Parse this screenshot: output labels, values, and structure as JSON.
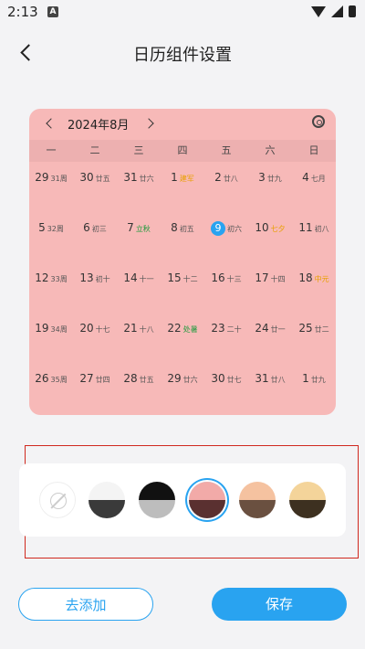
{
  "status": {
    "time": "2:13",
    "notif": "A"
  },
  "header": {
    "title": "日历组件设置"
  },
  "calendar": {
    "month_label": "2024年8月",
    "weekdays": [
      "一",
      "二",
      "三",
      "四",
      "五",
      "六",
      "日"
    ],
    "weeks": [
      [
        {
          "d": "29",
          "s": "31周",
          "c": "",
          "t": false
        },
        {
          "d": "30",
          "s": "廿五",
          "c": "",
          "t": false
        },
        {
          "d": "31",
          "s": "廿六",
          "c": "",
          "t": false
        },
        {
          "d": "1",
          "s": "建军",
          "c": "orange",
          "t": false
        },
        {
          "d": "2",
          "s": "廿八",
          "c": "",
          "t": false
        },
        {
          "d": "3",
          "s": "廿九",
          "c": "",
          "t": false
        },
        {
          "d": "4",
          "s": "七月",
          "c": "",
          "t": false
        }
      ],
      [
        {
          "d": "5",
          "s": "32周",
          "c": "",
          "t": false
        },
        {
          "d": "6",
          "s": "初三",
          "c": "",
          "t": false
        },
        {
          "d": "7",
          "s": "立秋",
          "c": "green",
          "t": false
        },
        {
          "d": "8",
          "s": "初五",
          "c": "",
          "t": false
        },
        {
          "d": "9",
          "s": "初六",
          "c": "",
          "t": true
        },
        {
          "d": "10",
          "s": "七夕",
          "c": "orange",
          "t": false
        },
        {
          "d": "11",
          "s": "初八",
          "c": "",
          "t": false
        }
      ],
      [
        {
          "d": "12",
          "s": "33周",
          "c": "",
          "t": false
        },
        {
          "d": "13",
          "s": "初十",
          "c": "",
          "t": false
        },
        {
          "d": "14",
          "s": "十一",
          "c": "",
          "t": false
        },
        {
          "d": "15",
          "s": "十二",
          "c": "",
          "t": false
        },
        {
          "d": "16",
          "s": "十三",
          "c": "",
          "t": false
        },
        {
          "d": "17",
          "s": "十四",
          "c": "",
          "t": false
        },
        {
          "d": "18",
          "s": "中元",
          "c": "orange",
          "t": false
        }
      ],
      [
        {
          "d": "19",
          "s": "34周",
          "c": "",
          "t": false
        },
        {
          "d": "20",
          "s": "十七",
          "c": "",
          "t": false
        },
        {
          "d": "21",
          "s": "十八",
          "c": "",
          "t": false
        },
        {
          "d": "22",
          "s": "处暑",
          "c": "green",
          "t": false
        },
        {
          "d": "23",
          "s": "二十",
          "c": "",
          "t": false
        },
        {
          "d": "24",
          "s": "廿一",
          "c": "",
          "t": false
        },
        {
          "d": "25",
          "s": "廿二",
          "c": "",
          "t": false
        }
      ],
      [
        {
          "d": "26",
          "s": "35周",
          "c": "",
          "t": false
        },
        {
          "d": "27",
          "s": "廿四",
          "c": "",
          "t": false
        },
        {
          "d": "28",
          "s": "廿五",
          "c": "",
          "t": false
        },
        {
          "d": "29",
          "s": "廿六",
          "c": "",
          "t": false
        },
        {
          "d": "30",
          "s": "廿七",
          "c": "",
          "t": false
        },
        {
          "d": "31",
          "s": "廿八",
          "c": "",
          "t": false
        },
        {
          "d": "1",
          "s": "廿九",
          "c": "",
          "t": false
        }
      ]
    ]
  },
  "styles": [
    {
      "name": "white-gray",
      "top": "#f4f4f4",
      "bottom": "#3a3a3a",
      "selected": false
    },
    {
      "name": "black-gray",
      "top": "#111111",
      "bottom": "#bdbdbd",
      "selected": false
    },
    {
      "name": "pink-brown",
      "top": "#f2aaa8",
      "bottom": "#5a3030",
      "selected": true
    },
    {
      "name": "peach-brown",
      "top": "#f5c2a0",
      "bottom": "#6a5040",
      "selected": false
    },
    {
      "name": "yellow-dark",
      "top": "#f4d49a",
      "bottom": "#3d3020",
      "selected": false
    }
  ],
  "buttons": {
    "add": "去添加",
    "save": "保存"
  }
}
